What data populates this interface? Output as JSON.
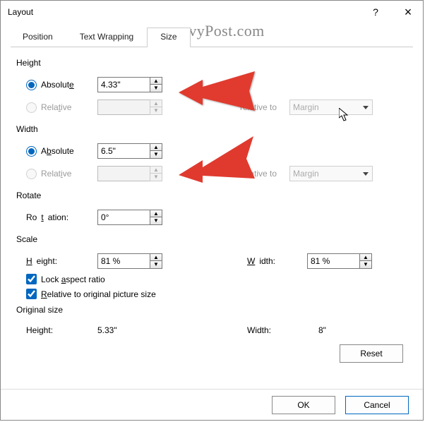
{
  "window": {
    "title": "Layout",
    "help_label": "?",
    "close_label": "×"
  },
  "watermark": "groovyPost.com",
  "tabs": {
    "position": "Position",
    "text_wrapping": "Text Wrapping",
    "size": "Size"
  },
  "height": {
    "section": "Height",
    "absolute_label_pre": "Absolut",
    "absolute_label_u": "e",
    "absolute_value": "4.33\"",
    "relative_label_pre": "Rela",
    "relative_label_u": "t",
    "relative_label_post": "ive",
    "relative_value": "",
    "relative_to_label": "relative to",
    "relative_to_value": "Margin"
  },
  "width": {
    "section": "Width",
    "absolute_label_pre": "A",
    "absolute_label_u": "b",
    "absolute_label_post": "solute",
    "absolute_value": "6.5\"",
    "relative_label_pre": "Relat",
    "relative_label_u": "i",
    "relative_label_post": "ve",
    "relative_value": "",
    "relative_to_label": "relative to",
    "relative_to_value": "Margin"
  },
  "rotate": {
    "section": "Rotate",
    "rotation_label_pre": "Ro",
    "rotation_label_u": "t",
    "rotation_label_post": "ation:",
    "rotation_value": "0°"
  },
  "scale": {
    "section": "Scale",
    "height_label_u": "H",
    "height_label_post": "eight:",
    "height_value": "81 %",
    "width_label_u": "W",
    "width_label_post": "idth:",
    "width_value": "81 %",
    "lock_label_pre": "Lock ",
    "lock_label_u": "a",
    "lock_label_post": "spect ratio",
    "rel_orig_label_u": "R",
    "rel_orig_label_post": "elative to original picture size"
  },
  "original": {
    "section": "Original size",
    "height_label": "Height:",
    "height_value": "5.33\"",
    "width_label": "Width:",
    "width_value": "8\""
  },
  "buttons": {
    "reset": "Reset",
    "ok": "OK",
    "cancel": "Cancel"
  }
}
